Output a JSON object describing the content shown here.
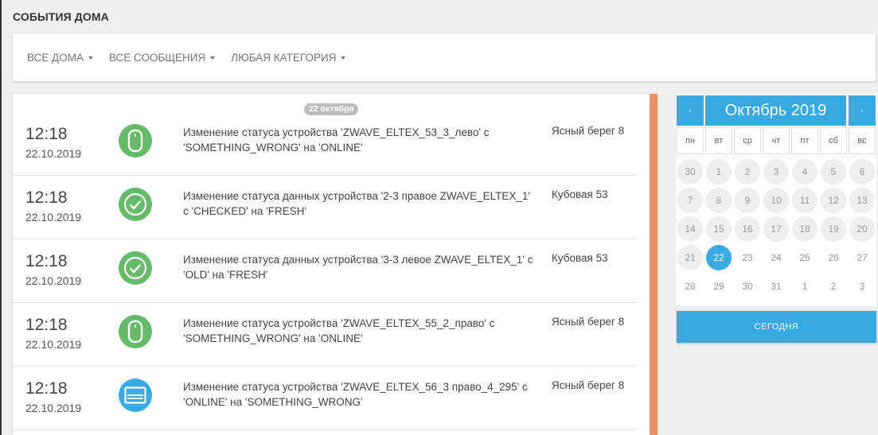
{
  "page": {
    "title": "СОБЫТИЯ ДОМА"
  },
  "filters": [
    {
      "label": "ВСЕ ДОМА"
    },
    {
      "label": "ВСЕ СООБЩЕНИЯ"
    },
    {
      "label": "ЛЮБАЯ КАТЕГОРИЯ"
    }
  ],
  "events": {
    "date_chip": "22 октября",
    "items": [
      {
        "time": "12:18",
        "date": "22.10.2019",
        "icon": "device-tag-icon",
        "icon_color": "#66bb6a",
        "text": "Изменение статуса устройства 'ZWAVE_ELTEX_53_3_лево' с 'SOMETHING_WRONG' на 'ONLINE'",
        "place": "Ясный берег 8"
      },
      {
        "time": "12:18",
        "date": "22.10.2019",
        "icon": "check-circle-icon",
        "icon_color": "#66bb6a",
        "text": "Изменение статуса данных устройства '2-3 правое ZWAVE_ELTEX_1' с 'CHECKED' на 'FRESH'",
        "place": "Кубовая 53"
      },
      {
        "time": "12:18",
        "date": "22.10.2019",
        "icon": "check-circle-icon",
        "icon_color": "#66bb6a",
        "text": "Изменение статуса данных устройства '3-3 левое ZWAVE_ELTEX_1' с 'OLD' на 'FRESH'",
        "place": "Кубовая 53"
      },
      {
        "time": "12:18",
        "date": "22.10.2019",
        "icon": "device-tag-icon",
        "icon_color": "#66bb6a",
        "text": "Изменение статуса устройства 'ZWAVE_ELTEX_55_2_право' с 'SOMETHING_WRONG' на 'ONLINE'",
        "place": "Ясный берег 8"
      },
      {
        "time": "12:18",
        "date": "22.10.2019",
        "icon": "window-icon",
        "icon_color": "#39a9e1",
        "text": "Изменение статуса устройства 'ZWAVE_ELTEX_56_3 право_4_295' с 'ONLINE' на 'SOMETHING_WRONG'",
        "place": "Ясный берег 8"
      }
    ]
  },
  "calendar": {
    "prev": "‹",
    "next": "›",
    "title": "Октябрь 2019",
    "weekdays": [
      "пн",
      "вт",
      "ср",
      "чт",
      "пт",
      "сб",
      "вс"
    ],
    "weeks": [
      [
        "30",
        "1",
        "2",
        "3",
        "4",
        "5",
        "6"
      ],
      [
        "7",
        "8",
        "9",
        "10",
        "11",
        "12",
        "13"
      ],
      [
        "14",
        "15",
        "16",
        "17",
        "18",
        "19",
        "20"
      ],
      [
        "21",
        "22",
        "23",
        "24",
        "25",
        "26",
        "27"
      ],
      [
        "28",
        "29",
        "30",
        "31",
        "1",
        "2",
        "3"
      ]
    ],
    "selected": "22",
    "accent": "#39a9e1"
  },
  "today_button": {
    "label": "СЕГОДНЯ"
  },
  "colors": {
    "accent": "#39a9e1",
    "success": "#66bb6a",
    "event_bar": "#ea8f6c"
  }
}
